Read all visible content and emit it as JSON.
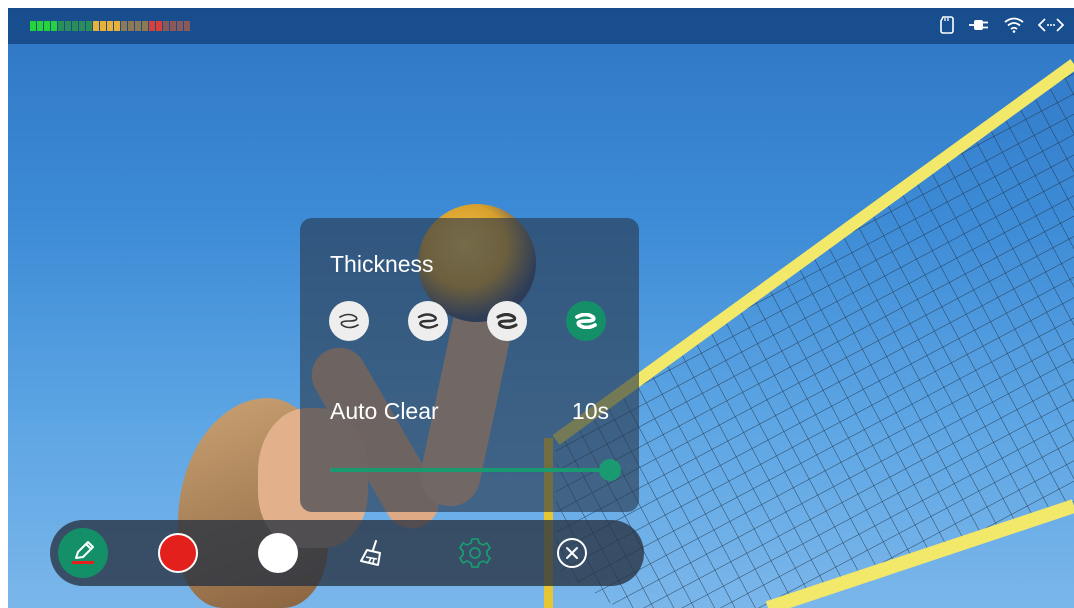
{
  "status_bar": {
    "level_meter": {
      "green": 9,
      "amber": 8,
      "red": 6,
      "active_green": 4,
      "active_amber": 4,
      "active_red": 2,
      "colors": {
        "green": "#27d33b",
        "amber": "#e8b13a",
        "red": "#d6423a",
        "inactive_green": "#2b8e5a",
        "inactive_amber": "#8d7a55",
        "inactive_red": "#8a5a5a"
      }
    },
    "icons": [
      "sd-card-icon",
      "power-plug-icon",
      "wifi-icon",
      "code-brackets-icon"
    ]
  },
  "settings_panel": {
    "thickness_label": "Thickness",
    "thickness_options": [
      {
        "name": "thin",
        "selected": false
      },
      {
        "name": "medium",
        "selected": false
      },
      {
        "name": "thick",
        "selected": false
      },
      {
        "name": "thickest",
        "selected": true
      }
    ],
    "auto_clear_label": "Auto Clear",
    "auto_clear_value": "10s",
    "auto_clear_slider_fraction": 1.0
  },
  "toolbar": {
    "items": [
      "pen-tool",
      "color-red",
      "color-white",
      "clear-broom",
      "settings",
      "close"
    ],
    "colors": {
      "accent": "#149068",
      "red": "#e4201c",
      "white": "#ffffff",
      "settings_icon": "#1a9a70"
    }
  }
}
